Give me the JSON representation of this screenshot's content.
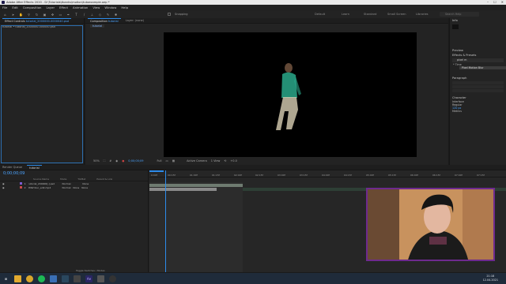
{
  "window": {
    "title": "Adobe After Effects 2020 - D:\\Tutorials\\tbanks\\motion\\tutoexample.aep *",
    "controls": [
      "–",
      "☐",
      "✕"
    ]
  },
  "menu": [
    "File",
    "Edit",
    "Composition",
    "Layer",
    "Effect",
    "Animation",
    "View",
    "Window",
    "Help"
  ],
  "toolbar": {
    "snapping": "Snapping",
    "workspaces": [
      "Default",
      "Learn",
      "Standard",
      "Small Screen",
      "Libraries"
    ],
    "search_placeholder": "Search Help"
  },
  "left_panel": {
    "tab": "Effect Controls",
    "tab_detail": "tutorial_2000000-0000040.psd",
    "layer": "tutorial • tutorial_2000000-000000.psd"
  },
  "viewer": {
    "tab": "Composition",
    "tab_detail": "tutorial",
    "layer_tab": "Layer: (none)",
    "sub_tab": "tutorial",
    "zoom": "50%",
    "resolution": "Full",
    "camera": "Active Camera",
    "views": "1 View",
    "offset": "+0.0"
  },
  "right_panel": {
    "info_title": "Info",
    "preview_title": "Preview",
    "effects_title": "Effects & Presets",
    "effects_search": "pixel m",
    "effects_group": "* Time",
    "effects_item": "Pixel Motion Blur",
    "paragraph_title": "Paragraph",
    "character_title": "Character",
    "font_name": "Interface",
    "font_style": "Regular",
    "font_size": "120 px",
    "tracking": "Metrics"
  },
  "timeline": {
    "tab_render": "Render Queue",
    "tab_comp": "tutorial",
    "timecode": "0;00;00;09",
    "columns": [
      "Source Name",
      "Mode",
      "TrkMat",
      "Parent & Link"
    ],
    "layers": [
      {
        "num": "1",
        "name": "tutorial_200000[-].psd",
        "mode": "Normal",
        "trkmat": "None",
        "parent": "None"
      },
      {
        "num": "2",
        "name": "PNW blur_ed2.mp4",
        "mode": "Normal",
        "trkmat": "None",
        "parent": "None"
      }
    ],
    "ruler": [
      "0:00f",
      "00:15f",
      "01:00f",
      "01:15f",
      "02:00f",
      "02:15f",
      "03:00f",
      "03:15f",
      "04:00f",
      "04:15f",
      "05:00f",
      "05:15f",
      "06:00f",
      "06:15f",
      "07:00f",
      "07:15f"
    ],
    "toggle_label": "Toggle Switches / Modes"
  },
  "taskbar": {
    "time": "21:18",
    "date": "12.04.2021"
  }
}
